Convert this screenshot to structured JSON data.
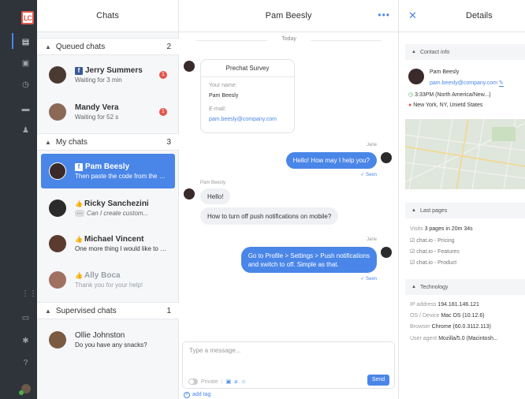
{
  "app": {
    "logo_text": "LC",
    "brand_color": "#e2574b",
    "accent_color": "#4a86e8"
  },
  "rail": {
    "icons": [
      "chats-icon",
      "contacts-icon",
      "history-icon",
      "archive-icon",
      "agents-icon",
      "apps-grid-icon",
      "billing-icon",
      "settings-icon",
      "help-icon",
      "avatar"
    ]
  },
  "list": {
    "title": "Chats",
    "sections": [
      {
        "label": "Queued chats",
        "count": "2"
      },
      {
        "label": "My chats",
        "count": "3"
      },
      {
        "label": "Supervised chats",
        "count": "1"
      }
    ],
    "queued": [
      {
        "name": "Jerry Summers",
        "sub": "Waiting for 3 min",
        "badge": "1",
        "source": "facebook-icon"
      },
      {
        "name": "Mandy Vera",
        "sub": "Waiting for 52 s",
        "badge": "1",
        "source": ""
      }
    ],
    "mine": [
      {
        "name": "Pam Beesly",
        "sub": "Then paste the code from the e...",
        "source": "facebook-icon"
      },
      {
        "name": "Ricky Sanchezini",
        "sub": "Can I create custom...",
        "source": "thumb-icon"
      },
      {
        "name": "Michael Vincent",
        "sub": "One more thing I would like to a...",
        "source": "thumb-icon"
      },
      {
        "name": "Ally Boca",
        "sub": "Thank you for your help!",
        "source": "thumb-icon"
      }
    ],
    "supervised": [
      {
        "name": "Ollie Johnston",
        "sub": "Do you have any snacks?"
      }
    ]
  },
  "chat": {
    "title": "Pam Beesly",
    "date": "Today",
    "survey": {
      "title": "Prechat Survey",
      "name_label": "Your name:",
      "name_value": "Pam Beesly",
      "email_label": "E-mail:",
      "email_value": "pam.beesly@company.com"
    },
    "agent_name": "Jane",
    "customer_name": "Pam Beesly",
    "msg_out_1": "Hello! How may I help you?",
    "msg_in_1": "Hello!",
    "msg_in_2": "How to turn off push notifications on mobile?",
    "msg_out_2_line1": "Go to Profile > Settings > Push notifications",
    "msg_out_2_line2": "and switch to off. Simple as that.",
    "seen_label": "✓ Seen",
    "composer_placeholder": "Type a message...",
    "private_label": "Private",
    "send_label": "Send",
    "add_tag_label": "add tag"
  },
  "details": {
    "title": "Details",
    "contact_section": "Contact info",
    "contact_name": "Pam Beesly",
    "contact_email": "pam.beesly@company.com",
    "local_time": "3:33PM (North America/New...)",
    "location": "New York, NY, Unietd States",
    "pages_section": "Last pages",
    "visits_label": "Visits",
    "visits_value": "3 pages in 20m 34s",
    "pages": [
      "chat.io - Pricing",
      "chat.io - Features",
      "chat.io - Product"
    ],
    "tech_section": "Technology",
    "ip_label": "IP address",
    "ip_value": "194.181.146.121",
    "os_label": "OS / Device",
    "os_value": "Mac OS (10.12.6)",
    "browser_label": "Browser",
    "browser_value": "Chrome (60.0.3112.113)",
    "ua_label": "User agent",
    "ua_value": "Mozilla/5.0 (Macintosh..."
  }
}
